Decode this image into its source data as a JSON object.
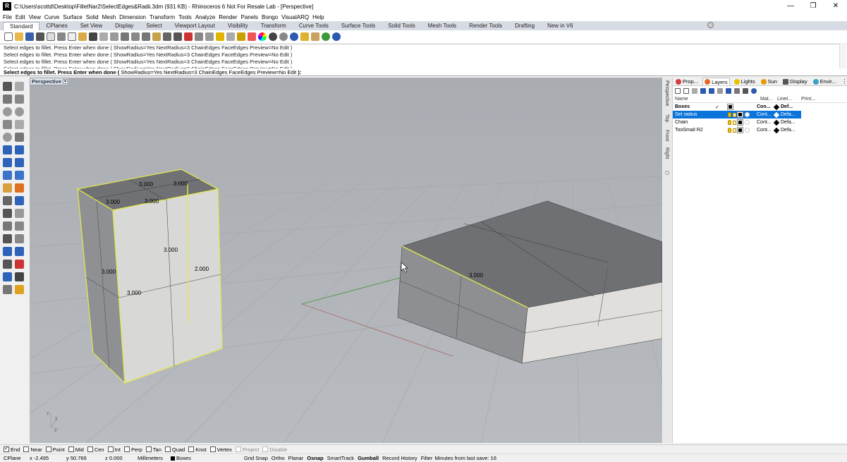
{
  "window": {
    "title": "C:\\Users\\scottd\\Desktop\\FilletNar2\\SelectEdges&Radii.3dm (931 KB) - Rhinoceros 6 Not For Resale Lab - [Perspective]",
    "minimize": "—",
    "restore": "❐",
    "close": "✕"
  },
  "menu": [
    "File",
    "Edit",
    "View",
    "Curve",
    "Surface",
    "Solid",
    "Mesh",
    "Dimension",
    "Transform",
    "Tools",
    "Analyze",
    "Render",
    "Panels",
    "Bongo",
    "VisualARQ",
    "Help"
  ],
  "toolbar_tabs": [
    "Standard",
    "CPlanes",
    "Set View",
    "Display",
    "Select",
    "Viewport Layout",
    "Visibility",
    "Transform",
    "Curve Tools",
    "Surface Tools",
    "Solid Tools",
    "Mesh Tools",
    "Render Tools",
    "Drafting",
    "New in V6"
  ],
  "command_history": [
    "Select edges to fillet. Press Enter when done ( ShowRadius=Yes  NextRadius=3  ChainEdges  FaceEdges  Preview=No  Edit )",
    "Select edges to fillet. Press Enter when done ( ShowRadius=Yes  NextRadius=3  ChainEdges  FaceEdges  Preview=No  Edit )",
    "Select edges to fillet. Press Enter when done ( ShowRadius=Yes  NextRadius=3  ChainEdges  FaceEdges  Preview=No  Edit )",
    "Select edges to fillet. Press Enter when done ( ShowRadius=Yes  NextRadius=3  ChainEdges  FaceEdges  Preview=No  Edit )"
  ],
  "command_prompt": {
    "main": "Select edges to fillet. Press Enter when done (",
    "opt1": "ShowRadius=Yes",
    "opt2": "NextRadius=3",
    "opt3": "ChainEdges",
    "opt4": "FaceEdges",
    "opt5": "Preview=No",
    "opt6": "Edit",
    "end": "):"
  },
  "viewport": {
    "name": "Perspective",
    "dropdown": "▾",
    "axis_z": "z",
    "axis_y": "y",
    "axis_x": "x",
    "dims_left": [
      "3.000",
      "3.000",
      "3.000",
      "3.000",
      "3.000",
      "3.000",
      "2.000",
      "3.000"
    ],
    "dims_right": [
      "3.000"
    ]
  },
  "side_view_tabs": [
    "Perspective",
    "Top",
    "Front",
    "Right"
  ],
  "panel": {
    "tabs": [
      {
        "label": "Prop...",
        "color": "#d63b3b"
      },
      {
        "label": "Layers",
        "color": "#e06a2a"
      },
      {
        "label": "Lights",
        "color": "#e8c200"
      },
      {
        "label": "Sun",
        "color": "#e89a00"
      },
      {
        "label": "Display",
        "color": "#555555"
      },
      {
        "label": "Envir...",
        "color": "#3aa0c8"
      }
    ],
    "columns": {
      "name": "Name",
      "mat": "Mat...",
      "linetype": "Linet...",
      "print": "Print..."
    },
    "layers": [
      {
        "name": "Boxes",
        "current": "✓",
        "linetype": "Con...",
        "print": "Def...",
        "bold": true
      },
      {
        "name": "Set radius",
        "current": "",
        "linetype": "Cont...",
        "print": "Defa...",
        "bold": false
      },
      {
        "name": "Chain",
        "current": "",
        "linetype": "Cont...",
        "print": "Defa...",
        "bold": false
      },
      {
        "name": "TooSmall R2",
        "current": "",
        "linetype": "Cont...",
        "print": "Defa...",
        "bold": false
      }
    ]
  },
  "osnaps": [
    {
      "label": "End",
      "checked": true
    },
    {
      "label": "Near",
      "checked": false
    },
    {
      "label": "Point",
      "checked": false
    },
    {
      "label": "Mid",
      "checked": false
    },
    {
      "label": "Cen",
      "checked": false
    },
    {
      "label": "Int",
      "checked": false
    },
    {
      "label": "Perp",
      "checked": false
    },
    {
      "label": "Tan",
      "checked": false
    },
    {
      "label": "Quad",
      "checked": false
    },
    {
      "label": "Knot",
      "checked": false
    },
    {
      "label": "Vertex",
      "checked": false
    },
    {
      "label": "Project",
      "checked": false,
      "disabled": true
    },
    {
      "label": "Disable",
      "checked": false,
      "disabled": true
    }
  ],
  "status": {
    "cplane": "CPlane",
    "x": "x -2.495",
    "y": "y 50.766",
    "z": "z 0.000",
    "units": "Millimeters",
    "layer": "Boxes",
    "grid_snap": "Grid Snap",
    "ortho": "Ortho",
    "planar": "Planar",
    "osnap": "Osnap",
    "smarttrack": "SmartTrack",
    "gumball": "Gumball",
    "record_history": "Record History",
    "filter": "Filter",
    "minutes": "Minutes from last save: 16"
  }
}
